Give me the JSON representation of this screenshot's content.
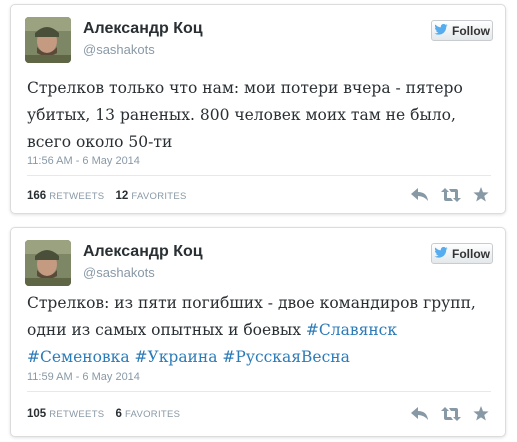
{
  "tweets": [
    {
      "name": "Александр Коц",
      "handle": "@sashakots",
      "follow_label": "Follow",
      "text": "Стрелков только что нам: мои потери вчера - пятеро убитых, 13 раненых. 800 человек моих там не было, всего около 50-ти",
      "time": "11:56 AM - 6 May 2014",
      "retweets": "166",
      "retweets_label": "RETWEETS",
      "favorites": "12",
      "favorites_label": "FAVORITES"
    },
    {
      "name": "Александр Коц",
      "handle": "@sashakots",
      "follow_label": "Follow",
      "text_prefix": "Стрелков: из пяти погибших - двое командиров групп, одни из самых опытных и боевых ",
      "hashtags": [
        "#Славянск",
        "#Семеновка",
        "#Украина",
        "#РусскаяВесна"
      ],
      "time": "11:59 AM - 6 May 2014",
      "retweets": "105",
      "retweets_label": "RETWEETS",
      "favorites": "6",
      "favorites_label": "FAVORITES"
    }
  ],
  "colors": {
    "hashtag": "#2b7bb9",
    "twitter_bird": "#55acee",
    "meta_text": "#8899a6",
    "text": "#292f33"
  },
  "icons": [
    "twitter-bird-icon",
    "reply-icon",
    "retweet-icon",
    "favorite-icon"
  ]
}
